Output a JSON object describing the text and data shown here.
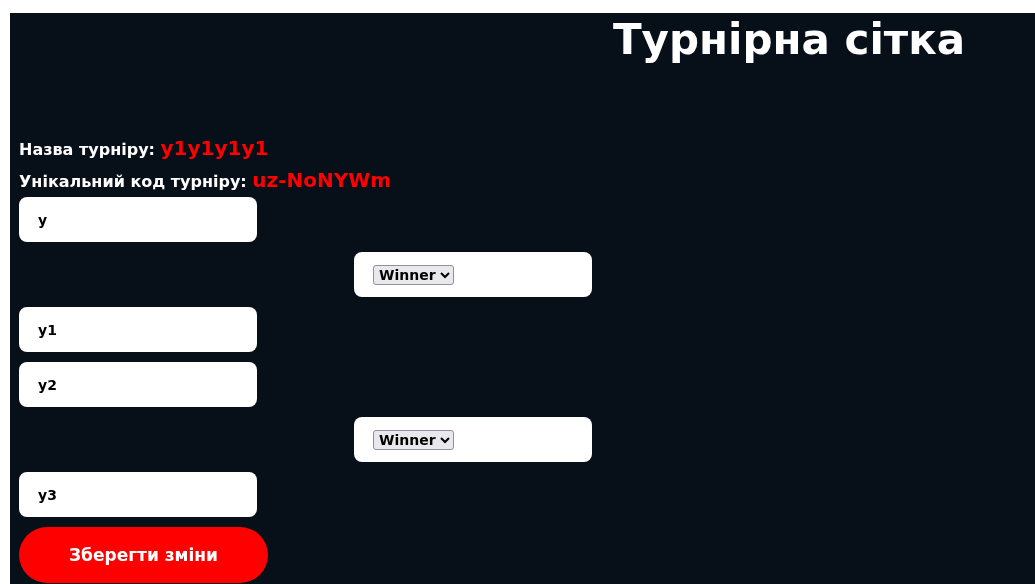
{
  "title": "Турнірна сітка",
  "tournament": {
    "name_label": "Назва турніру:",
    "name": "y1y1y1y1",
    "code_label": "Унікальний код турніру:",
    "code": "uz-NoNYWm"
  },
  "matches": [
    {
      "players": [
        "y",
        "y1"
      ],
      "winner": "Winner"
    },
    {
      "players": [
        "y2",
        "y3"
      ],
      "winner": "Winner"
    }
  ],
  "save_button": "Зберегти зміни"
}
